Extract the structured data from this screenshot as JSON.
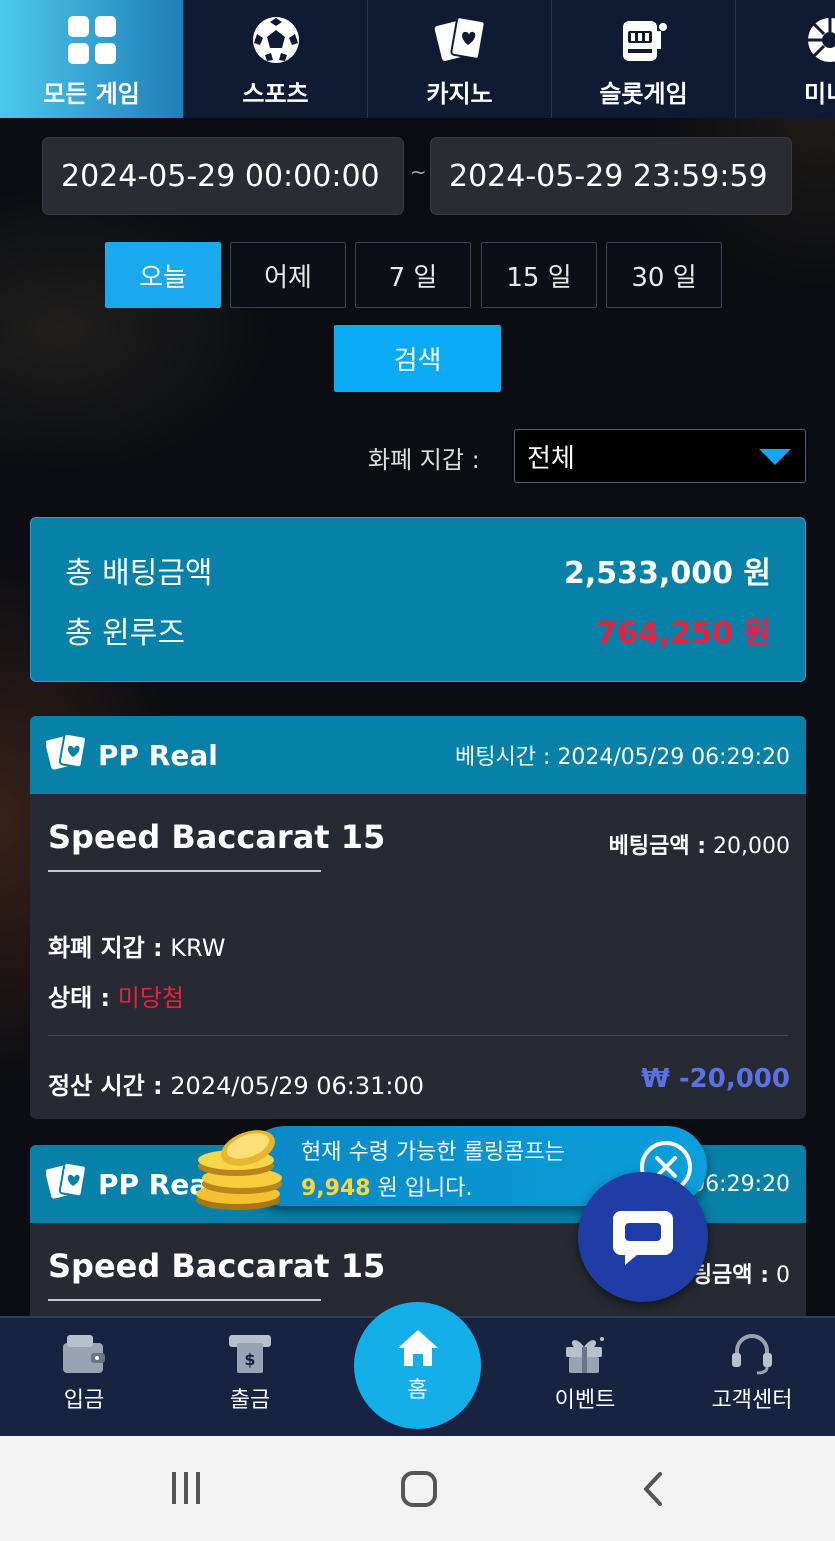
{
  "top_tabs": [
    {
      "label": "모든 게임",
      "icon": "grid-icon",
      "active": true
    },
    {
      "label": "스포츠",
      "icon": "soccer-ball-icon",
      "active": false
    },
    {
      "label": "카지노",
      "icon": "cards-icon",
      "active": false
    },
    {
      "label": "슬롯게임",
      "icon": "slot-machine-icon",
      "active": false
    },
    {
      "label": "미니",
      "icon": "mini-game-icon",
      "active": false
    }
  ],
  "filter": {
    "start_date": "2024-05-29 00:00:00",
    "separator": "~",
    "end_date": "2024-05-29 23:59:59",
    "periods": [
      "오늘",
      "어제",
      "7 일",
      "15 일",
      "30 일"
    ],
    "active_period": "오늘",
    "search_label": "검색",
    "wallet_label": "화폐 지갑 :",
    "wallet_value": "전체"
  },
  "summary": {
    "total_bet_label": "총 배팅금액",
    "total_bet_value": "2,533,000 원",
    "total_winloss_label": "총 윈루즈",
    "total_winloss_value": "764,250 원"
  },
  "bets": [
    {
      "provider": "PP Real",
      "bet_time_label": "베팅시간 :",
      "bet_time": "2024/05/29 06:29:20",
      "game": "Speed Baccarat 15",
      "bet_amount_label": "베팅금액 :",
      "bet_amount": "20,000",
      "wallet_label": "화폐 지갑 :",
      "wallet": "KRW",
      "status_label": "상태 :",
      "status": "미당첨",
      "settle_label": "정산 시간 :",
      "settle_time": "2024/05/29 06:31:00",
      "settle_amount": "₩ -20,000"
    },
    {
      "provider": "PP Real",
      "bet_time_partial": "06:29:20",
      "game": "Speed Baccarat 15",
      "bet_amount_label_partial": "팅금액 :",
      "bet_amount": "0"
    }
  ],
  "toast": {
    "line1": "현재 수령 가능한 롤링콤프는",
    "amount": "9,948",
    "line2_suffix": " 원 입니다."
  },
  "bottom_nav": [
    {
      "label": "입금",
      "icon": "wallet-icon"
    },
    {
      "label": "출금",
      "icon": "cash-withdraw-icon"
    },
    {
      "label": "홈",
      "icon": "home-icon"
    },
    {
      "label": "이벤트",
      "icon": "gift-icon"
    },
    {
      "label": "고객센터",
      "icon": "headset-icon"
    }
  ],
  "colors": {
    "accent": "#0aaaf5",
    "card_header": "#0781a8",
    "loss_red": "#e8213f",
    "settle_blue": "#5b72e6",
    "toast_amount": "#ffd43b"
  }
}
